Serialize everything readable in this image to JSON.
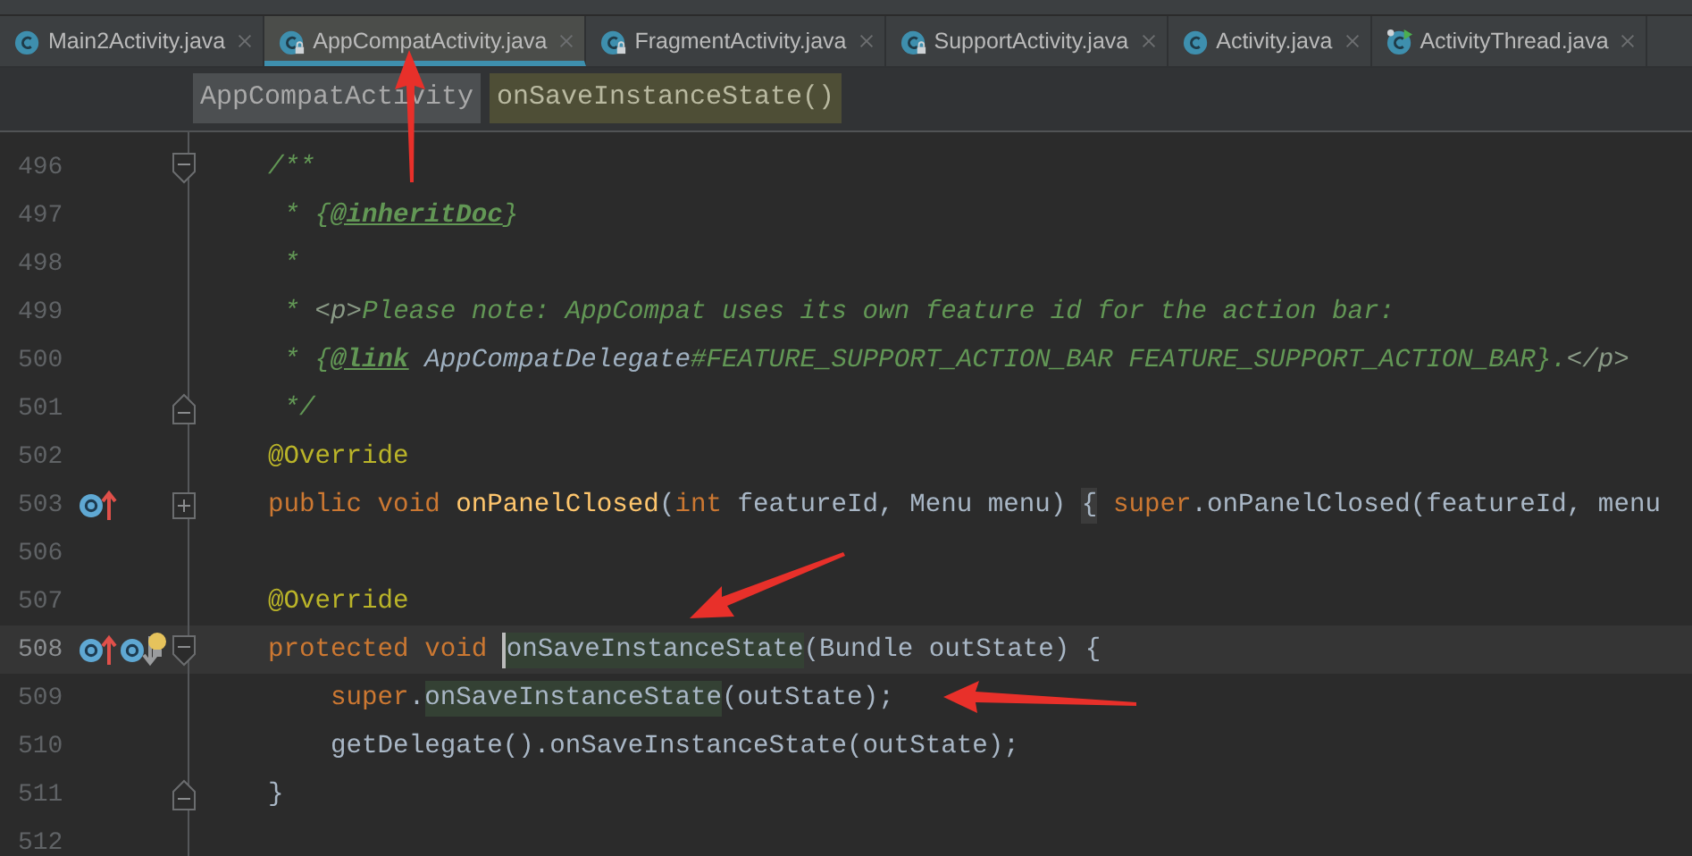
{
  "tabs": [
    {
      "label": "Main2Activity.java",
      "selected": false,
      "kind": "class"
    },
    {
      "label": "AppCompatActivity.java",
      "selected": true,
      "kind": "locked"
    },
    {
      "label": "FragmentActivity.java",
      "selected": false,
      "kind": "locked"
    },
    {
      "label": "SupportActivity.java",
      "selected": false,
      "kind": "locked"
    },
    {
      "label": "Activity.java",
      "selected": false,
      "kind": "class"
    },
    {
      "label": "ActivityThread.java",
      "selected": false,
      "kind": "running"
    }
  ],
  "breadcrumbs": [
    {
      "label": "AppCompatActivity",
      "selected": false
    },
    {
      "label": "onSaveInstanceState()",
      "selected": true
    }
  ],
  "lines": [
    {
      "number": "496",
      "current": false,
      "gutter_icons": [
        {
          "kind": "fold-start"
        }
      ],
      "tokens": [
        {
          "text": "/**",
          "kind": "comment"
        }
      ]
    },
    {
      "number": "497",
      "current": false,
      "tokens": [
        {
          "text": " * {",
          "kind": "comment"
        },
        {
          "text": "@inheritDoc",
          "kind": "doctag"
        },
        {
          "text": "}",
          "kind": "comment"
        }
      ]
    },
    {
      "number": "498",
      "current": false,
      "tokens": [
        {
          "text": " *",
          "kind": "comment"
        }
      ]
    },
    {
      "number": "499",
      "current": false,
      "tokens": [
        {
          "text": " * ",
          "kind": "comment"
        },
        {
          "text": "<p>",
          "kind": "html"
        },
        {
          "text": "Please note: AppCompat uses its own feature id for the action bar:",
          "kind": "comment"
        }
      ]
    },
    {
      "number": "500",
      "current": false,
      "tokens": [
        {
          "text": " * {",
          "kind": "comment"
        },
        {
          "text": "@link",
          "kind": "doctag"
        },
        {
          "text": " AppCompatDelegate",
          "kind": "doclink"
        },
        {
          "text": "#FEATURE_SUPPORT_ACTION_BAR FEATURE_SUPPORT_ACTION_BAR}.",
          "kind": "comment"
        },
        {
          "text": "</p>",
          "kind": "html"
        }
      ]
    },
    {
      "number": "501",
      "current": false,
      "gutter_icons": [
        {
          "kind": "fold-end"
        }
      ],
      "tokens": [
        {
          "text": " */",
          "kind": "comment"
        }
      ]
    },
    {
      "number": "502",
      "current": false,
      "tokens": [
        {
          "text": "@Override",
          "kind": "annotation"
        }
      ]
    },
    {
      "number": "503",
      "current": false,
      "gutter_icons": [
        {
          "kind": "overriding"
        },
        {
          "kind": "fold-collapsed"
        }
      ],
      "tokens": [
        {
          "text": "public void ",
          "kind": "keyword"
        },
        {
          "text": "onPanelClosed",
          "kind": "method"
        },
        {
          "text": "(",
          "kind": "plain"
        },
        {
          "text": "int ",
          "kind": "keyword"
        },
        {
          "text": "featureId, Menu menu) ",
          "kind": "plain"
        },
        {
          "text": "{",
          "kind": "folded"
        },
        {
          "text": " super",
          "kind": "keyword"
        },
        {
          "text": ".onPanelClosed(featureId, menu",
          "kind": "plain"
        }
      ]
    },
    {
      "number": "506",
      "current": false
    },
    {
      "number": "507",
      "current": false,
      "tokens": [
        {
          "text": "@Override",
          "kind": "annotation"
        }
      ]
    },
    {
      "number": "508",
      "current": true,
      "gutter_icons": [
        {
          "kind": "overriding"
        },
        {
          "kind": "overridden"
        },
        {
          "kind": "bulb"
        },
        {
          "kind": "fold-start"
        }
      ],
      "tokens": [
        {
          "text": "protected void ",
          "kind": "keyword"
        },
        {
          "text": "onSaveInstanceState",
          "kind": "usage-decl"
        },
        {
          "text": "(Bundle outState) {",
          "kind": "plain"
        }
      ]
    },
    {
      "number": "509",
      "current": false,
      "tokens": [
        {
          "text": "    super",
          "kind": "keyword"
        },
        {
          "text": ".",
          "kind": "plain"
        },
        {
          "text": "onSaveInstanceState",
          "kind": "usage"
        },
        {
          "text": "(outState);",
          "kind": "plain"
        }
      ]
    },
    {
      "number": "510",
      "current": false,
      "tokens": [
        {
          "text": "    getDelegate().onSaveInstanceState(outState);",
          "kind": "plain"
        }
      ]
    },
    {
      "number": "511",
      "current": false,
      "gutter_icons": [
        {
          "kind": "fold-end"
        }
      ],
      "tokens": [
        {
          "text": "}",
          "kind": "plain"
        }
      ]
    },
    {
      "number": "512",
      "current": false
    }
  ]
}
